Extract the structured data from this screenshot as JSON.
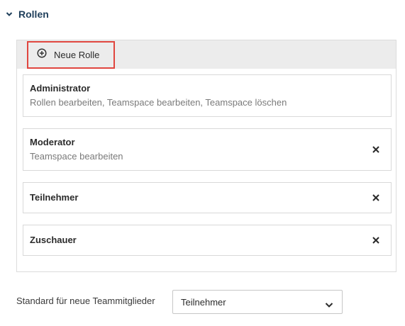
{
  "section": {
    "title": "Rollen",
    "expanded": true
  },
  "toolbar": {
    "new_role_label": "Neue Rolle"
  },
  "roles": [
    {
      "name": "Administrator",
      "permissions": "Rollen bearbeiten, Teamspace bearbeiten, Teamspace löschen",
      "removable": false
    },
    {
      "name": "Moderator",
      "permissions": "Teamspace bearbeiten",
      "removable": true
    },
    {
      "name": "Teilnehmer",
      "permissions": "",
      "removable": true
    },
    {
      "name": "Zuschauer",
      "permissions": "",
      "removable": true
    }
  ],
  "default_role": {
    "label": "Standard für neue Teammitglieder",
    "selected": "Teilnehmer"
  },
  "colors": {
    "highlight_border": "#e0463f",
    "section_title": "#1f3f5b"
  }
}
